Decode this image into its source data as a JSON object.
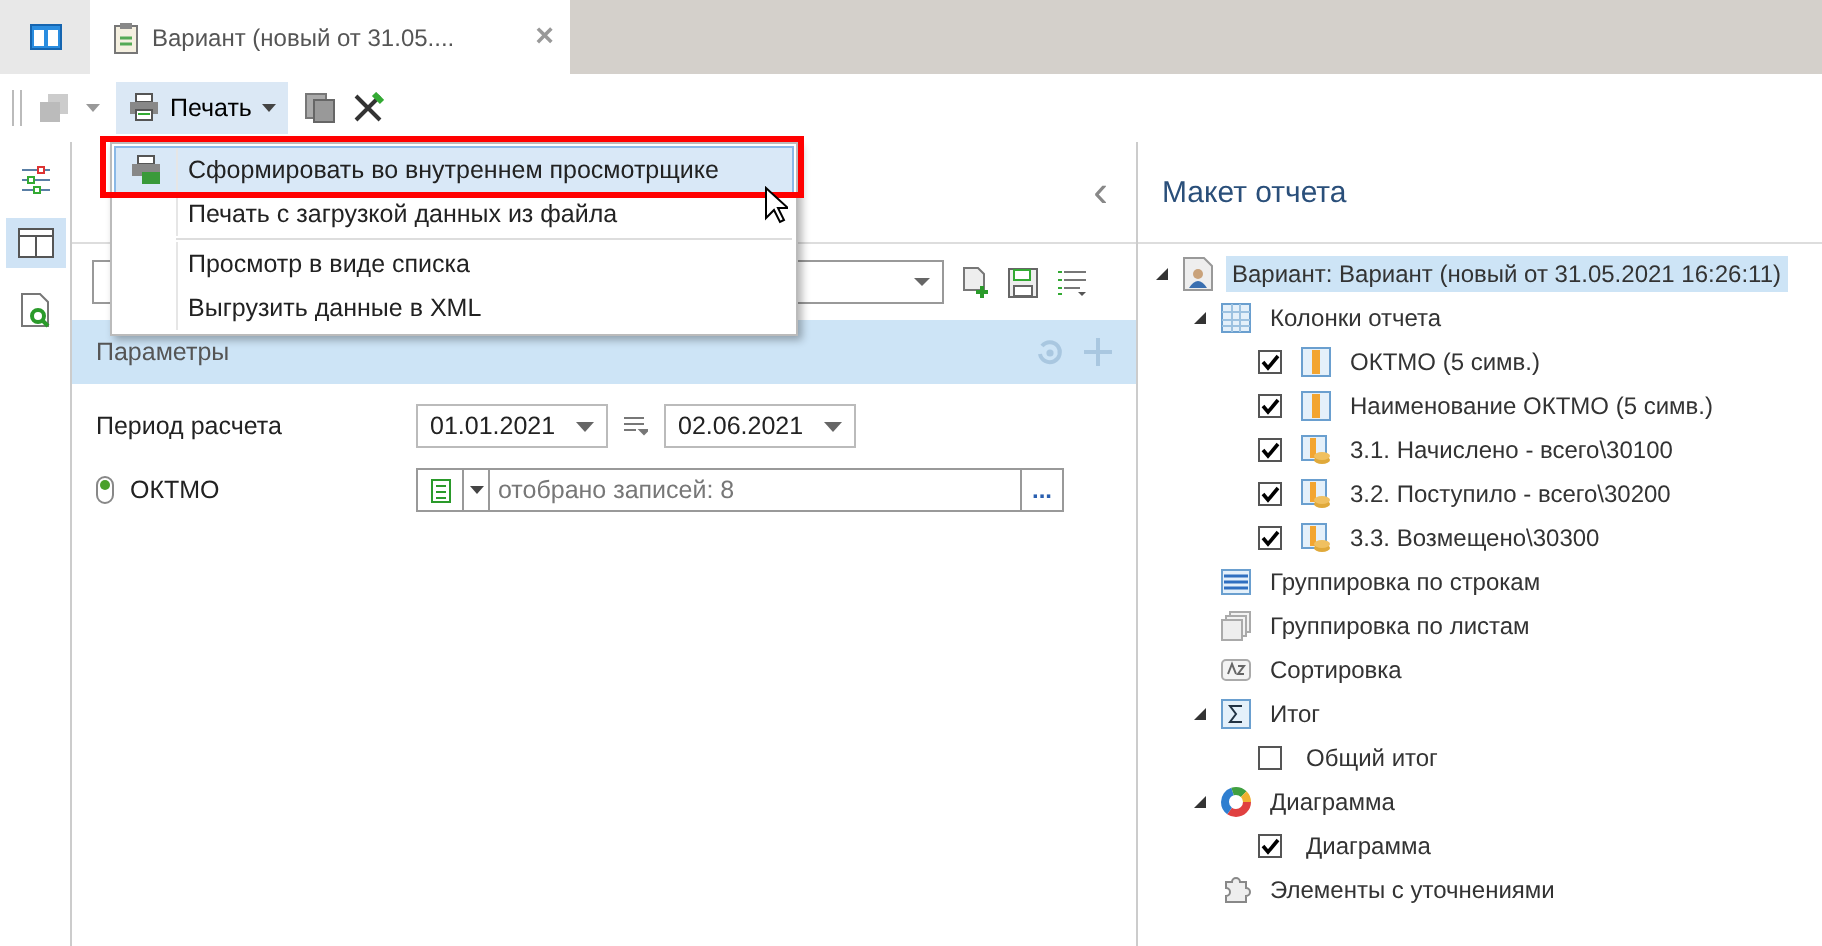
{
  "tab": {
    "title": "Вариант (новый от 31.05....",
    "close": "×",
    "selected": true
  },
  "toolbar": {
    "print": "Печать"
  },
  "menu": {
    "items": [
      {
        "label": "Сформировать во внутреннем просмотрщике",
        "selected": true,
        "kind": "icon"
      },
      {
        "label": "Печать с загрузкой данных из файла",
        "selected": false,
        "kind": "plain"
      },
      {
        "label": "Просмотр в виде списка",
        "selected": false,
        "kind": "plain"
      },
      {
        "label": "Выгрузить данные в XML",
        "selected": false,
        "kind": "plain"
      }
    ]
  },
  "params": {
    "collapse": "‹",
    "header": "Параметры",
    "period_label": "Период расчета",
    "date_from": "01.01.2021",
    "date_to": "02.06.2021",
    "oktmo_label": "ОКТМО",
    "oktmo_value": "отобрано записей: 8",
    "oktmo_button": "..."
  },
  "layout": {
    "title": "Макет отчета",
    "tree": [
      {
        "label": "Вариант: Вариант (новый от 31.05.2021 16:26:11)",
        "kind": "variant",
        "expanded": true,
        "selected": true,
        "children": [
          {
            "label": "Колонки отчета",
            "kind": "table",
            "expanded": true,
            "selected": false,
            "children": [
              {
                "label": "ОКТМО (5 симв.)",
                "kind": "column",
                "checked": true,
                "selected": false
              },
              {
                "label": "Наименование ОКТМО (5 симв.)",
                "kind": "column",
                "checked": true,
                "selected": false
              },
              {
                "label": "3.1. Начислено - всего\\30100",
                "kind": "coins",
                "checked": true,
                "selected": false
              },
              {
                "label": "3.2. Поступило - всего\\30200",
                "kind": "coins",
                "checked": true,
                "selected": false
              },
              {
                "label": "3.3. Возмещено\\30300",
                "kind": "coins",
                "checked": true,
                "selected": false
              }
            ]
          },
          {
            "label": "Группировка по строкам",
            "kind": "rows",
            "selected": false
          },
          {
            "label": "Группировка по листам",
            "kind": "sheets",
            "selected": false
          },
          {
            "label": "Сортировка",
            "kind": "sort",
            "selected": false
          },
          {
            "label": "Итог",
            "kind": "sum",
            "expanded": true,
            "selected": false,
            "children": [
              {
                "label": "Общий итог",
                "checked": false,
                "selected": false
              }
            ]
          },
          {
            "label": "Диаграмма",
            "kind": "chart",
            "expanded": true,
            "selected": false,
            "children": [
              {
                "label": "Диаграмма",
                "checked": true,
                "selected": false
              }
            ]
          },
          {
            "label": "Элементы с уточнениями",
            "kind": "puzzle",
            "selected": false
          }
        ]
      }
    ]
  }
}
